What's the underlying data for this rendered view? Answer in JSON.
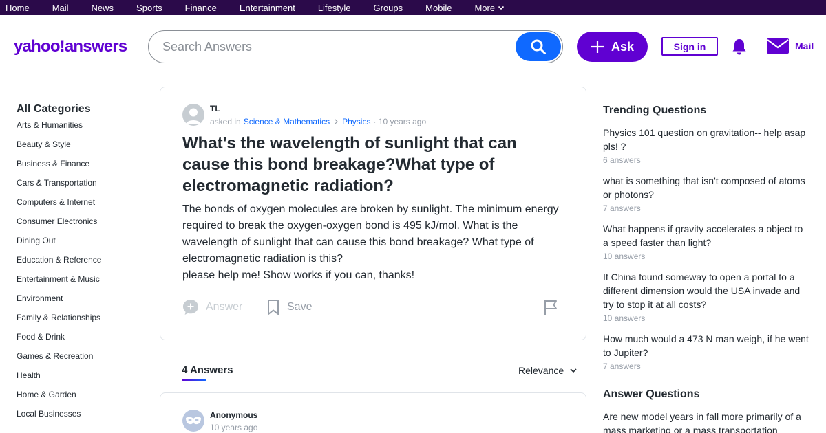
{
  "topnav": {
    "items": [
      "Home",
      "Mail",
      "News",
      "Sports",
      "Finance",
      "Entertainment",
      "Lifestyle",
      "Groups",
      "Mobile",
      "More"
    ]
  },
  "header": {
    "logo_text": "yahoo!answers",
    "search_placeholder": "Search Answers",
    "ask_label": "Ask",
    "signin_label": "Sign in",
    "mail_label": "Mail"
  },
  "sidebar": {
    "title": "All Categories",
    "items": [
      "Arts & Humanities",
      "Beauty & Style",
      "Business & Finance",
      "Cars & Transportation",
      "Computers & Internet",
      "Consumer Electronics",
      "Dining Out",
      "Education & Reference",
      "Entertainment & Music",
      "Environment",
      "Family & Relationships",
      "Food & Drink",
      "Games & Recreation",
      "Health",
      "Home & Garden",
      "Local Businesses"
    ]
  },
  "question": {
    "asker": "TL",
    "asked_in": "asked in",
    "category": "Science & Mathematics",
    "subcategory": "Physics",
    "time": "· 10 years ago",
    "title": "What's the wavelength of sunlight that can cause this bond breakage?What type of electromagnetic radiation?",
    "body_line1": "The bonds of oxygen molecules are broken by sunlight. The minimum energy required to break the oxygen-oxygen bond is 495 kJ/mol. What is the wavelength of sunlight that can cause this bond breakage? What type of electromagnetic radiation is this?",
    "body_line2": "please help me! Show works if you can, thanks!",
    "answer_label": "Answer",
    "save_label": "Save"
  },
  "answers": {
    "count_label": "4 Answers",
    "sort_label": "Relevance",
    "first": {
      "name": "Anonymous",
      "time": "10 years ago"
    }
  },
  "trending": {
    "title": "Trending Questions",
    "items": [
      {
        "q": "Physics 101 question on gravitation-- help asap pls! ?",
        "count": "6 answers"
      },
      {
        "q": "what is something that isn't composed of atoms or photons?",
        "count": "7 answers"
      },
      {
        "q": "What happens if gravity accelerates a object to a speed faster than light?",
        "count": "10 answers"
      },
      {
        "q": "If China found someway to open a portal to a different dimension would the USA invade and try to stop it at all costs?",
        "count": "10 answers"
      },
      {
        "q": "How much would a 473 N man weigh, if he went to Jupiter?",
        "count": "7 answers"
      }
    ]
  },
  "answer_questions": {
    "title": "Answer Questions",
    "first": "Are new model years in fall more primarily of a mass marketing or a mass transportation"
  },
  "colors": {
    "brand": "#6001d2",
    "nav_bg": "#2b0a4a",
    "search_blue": "#0f69ff",
    "link_blue": "#0f69ff"
  },
  "icons": [
    "chevron-down-icon",
    "search-icon",
    "plus-icon",
    "bell-icon",
    "mail-icon",
    "avatar-icon",
    "answer-plus-icon",
    "bookmark-icon",
    "flag-icon",
    "anonymous-mask-icon",
    "chevron-right-icon"
  ]
}
